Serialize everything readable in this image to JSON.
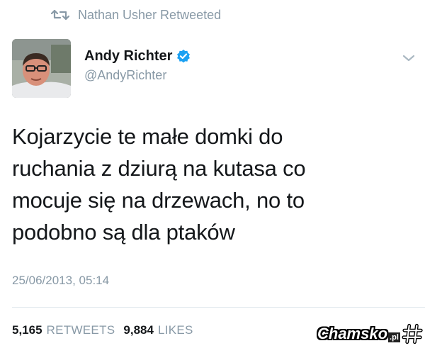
{
  "retweet": {
    "icon": "retweet-icon",
    "text": "Nathan Usher Retweeted"
  },
  "author": {
    "name": "Andy Richter",
    "handle": "@AndyRichter",
    "verified": true,
    "verified_color": "#1da1f2"
  },
  "tweet": {
    "lines": [
      "Kojarzycie te małe domki do",
      "ruchania z dziurą na kutasa co",
      "mocuje się na drzewach, no to",
      "podobno są dla ptaków"
    ],
    "timestamp": "25/06/2013, 05:14"
  },
  "stats": {
    "retweets_count": "5,165",
    "retweets_label": "RETWEETS",
    "likes_count": "9,884",
    "likes_label": "LIKES"
  },
  "watermark": {
    "text": "Chamsko",
    "tld": ".pl"
  },
  "colors": {
    "secondary_text": "#8899a6",
    "primary_text": "#14171a",
    "divider": "#e1e8ed"
  }
}
